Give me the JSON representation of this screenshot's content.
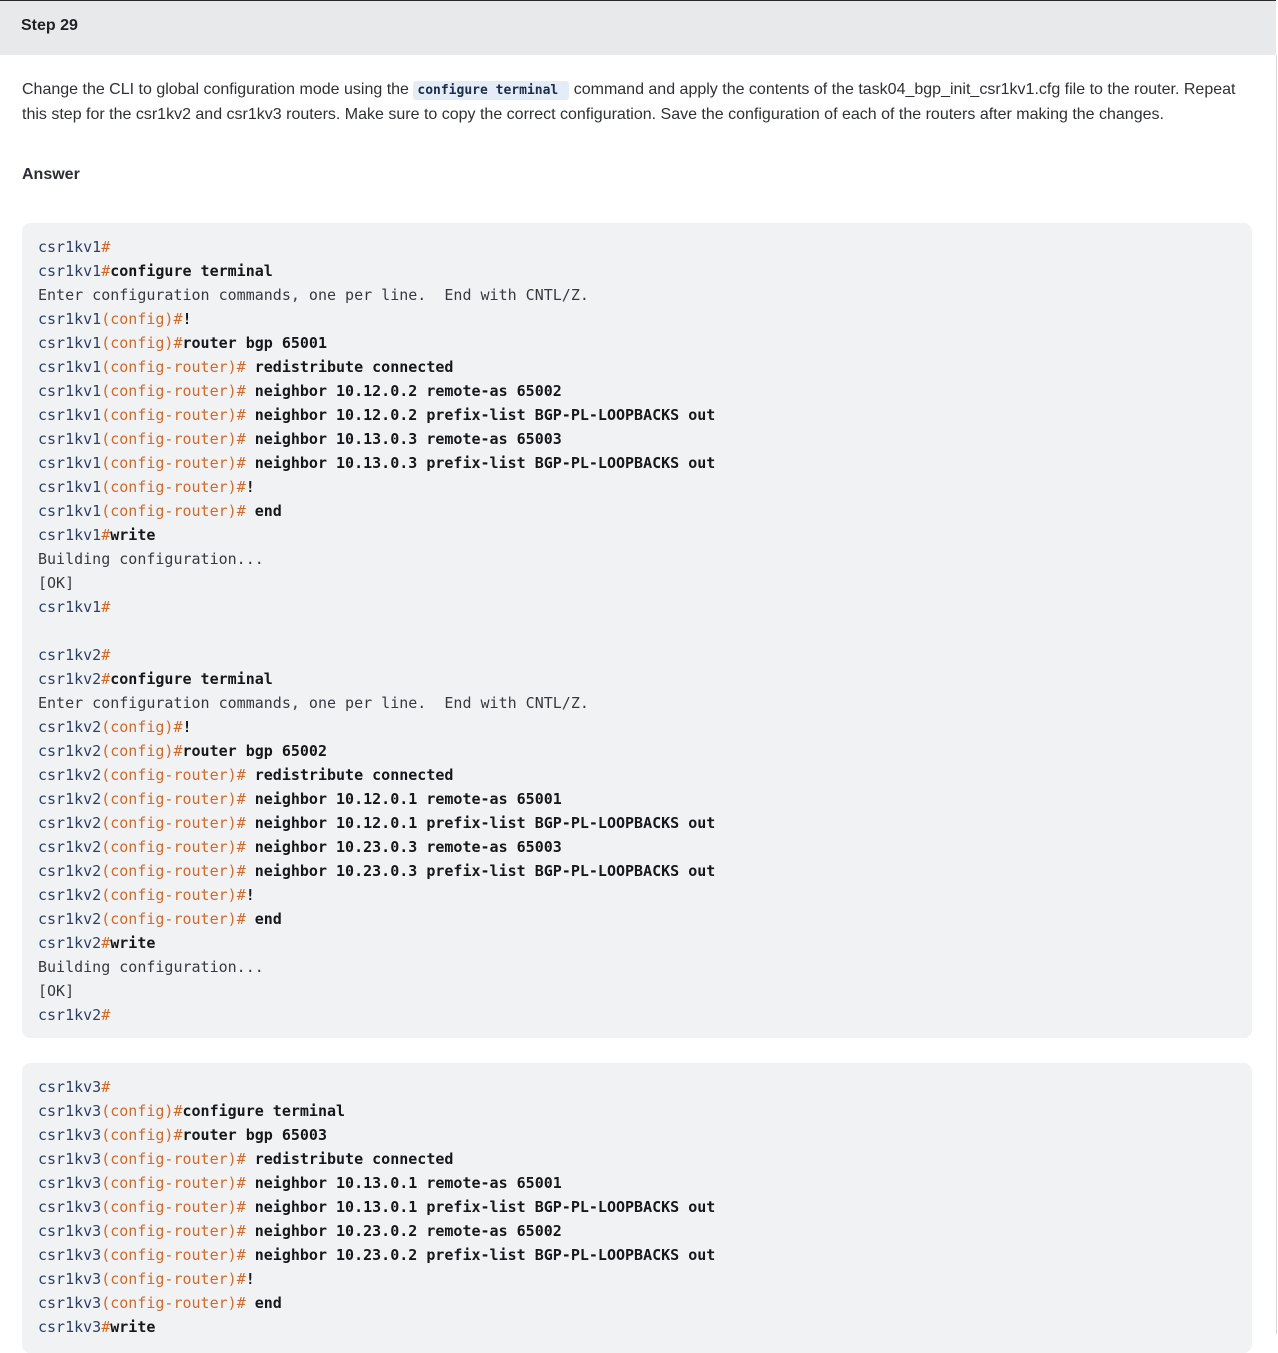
{
  "step": {
    "title": "Step 29"
  },
  "instruction": {
    "text_before": "Change the CLI to global configuration mode using the ",
    "code": "configure terminal",
    "text_after": " command and apply the contents of the task04_bgp_init_csr1kv1.cfg file to the router. Repeat this step for the csr1kv2 and csr1kv3 routers. Make sure to copy the correct configuration. Save the configuration of each of the routers after making the changes."
  },
  "answer_label": "Answer",
  "code_blocks": [
    {
      "lines": [
        {
          "host": "csr1kv1",
          "mode": "",
          "cmd": ""
        },
        {
          "host": "csr1kv1",
          "mode": "",
          "cmd": "configure terminal"
        },
        {
          "output": "Enter configuration commands, one per line.  End with CNTL/Z."
        },
        {
          "host": "csr1kv1",
          "mode": "(config)",
          "cmd": "!"
        },
        {
          "host": "csr1kv1",
          "mode": "(config)",
          "cmd": "router bgp 65001"
        },
        {
          "host": "csr1kv1",
          "mode": "(config-router)",
          "cmd": " redistribute connected"
        },
        {
          "host": "csr1kv1",
          "mode": "(config-router)",
          "cmd": " neighbor 10.12.0.2 remote-as 65002"
        },
        {
          "host": "csr1kv1",
          "mode": "(config-router)",
          "cmd": " neighbor 10.12.0.2 prefix-list BGP-PL-LOOPBACKS out"
        },
        {
          "host": "csr1kv1",
          "mode": "(config-router)",
          "cmd": " neighbor 10.13.0.3 remote-as 65003"
        },
        {
          "host": "csr1kv1",
          "mode": "(config-router)",
          "cmd": " neighbor 10.13.0.3 prefix-list BGP-PL-LOOPBACKS out"
        },
        {
          "host": "csr1kv1",
          "mode": "(config-router)",
          "cmd": "!"
        },
        {
          "host": "csr1kv1",
          "mode": "(config-router)",
          "cmd": " end"
        },
        {
          "host": "csr1kv1",
          "mode": "",
          "cmd": "write"
        },
        {
          "output": "Building configuration..."
        },
        {
          "output": "[OK]"
        },
        {
          "host": "csr1kv1",
          "mode": "",
          "cmd": ""
        },
        {
          "output": ""
        },
        {
          "host": "csr1kv2",
          "mode": "",
          "cmd": ""
        },
        {
          "host": "csr1kv2",
          "mode": "",
          "cmd": "configure terminal"
        },
        {
          "output": "Enter configuration commands, one per line.  End with CNTL/Z."
        },
        {
          "host": "csr1kv2",
          "mode": "(config)",
          "cmd": "!"
        },
        {
          "host": "csr1kv2",
          "mode": "(config)",
          "cmd": "router bgp 65002"
        },
        {
          "host": "csr1kv2",
          "mode": "(config-router)",
          "cmd": " redistribute connected"
        },
        {
          "host": "csr1kv2",
          "mode": "(config-router)",
          "cmd": " neighbor 10.12.0.1 remote-as 65001"
        },
        {
          "host": "csr1kv2",
          "mode": "(config-router)",
          "cmd": " neighbor 10.12.0.1 prefix-list BGP-PL-LOOPBACKS out"
        },
        {
          "host": "csr1kv2",
          "mode": "(config-router)",
          "cmd": " neighbor 10.23.0.3 remote-as 65003"
        },
        {
          "host": "csr1kv2",
          "mode": "(config-router)",
          "cmd": " neighbor 10.23.0.3 prefix-list BGP-PL-LOOPBACKS out"
        },
        {
          "host": "csr1kv2",
          "mode": "(config-router)",
          "cmd": "!"
        },
        {
          "host": "csr1kv2",
          "mode": "(config-router)",
          "cmd": " end"
        },
        {
          "host": "csr1kv2",
          "mode": "",
          "cmd": "write"
        },
        {
          "output": "Building configuration..."
        },
        {
          "output": "[OK]"
        },
        {
          "host": "csr1kv2",
          "mode": "",
          "cmd": ""
        }
      ]
    },
    {
      "lines": [
        {
          "host": "csr1kv3",
          "mode": "",
          "cmd": ""
        },
        {
          "host": "csr1kv3",
          "mode": "(config)",
          "cmd": "configure terminal"
        },
        {
          "host": "csr1kv3",
          "mode": "(config)",
          "cmd": "router bgp 65003"
        },
        {
          "host": "csr1kv3",
          "mode": "(config-router)",
          "cmd": " redistribute connected"
        },
        {
          "host": "csr1kv3",
          "mode": "(config-router)",
          "cmd": " neighbor 10.13.0.1 remote-as 65001"
        },
        {
          "host": "csr1kv3",
          "mode": "(config-router)",
          "cmd": " neighbor 10.13.0.1 prefix-list BGP-PL-LOOPBACKS out"
        },
        {
          "host": "csr1kv3",
          "mode": "(config-router)",
          "cmd": " neighbor 10.23.0.2 remote-as 65002"
        },
        {
          "host": "csr1kv3",
          "mode": "(config-router)",
          "cmd": " neighbor 10.23.0.2 prefix-list BGP-PL-LOOPBACKS out"
        },
        {
          "host": "csr1kv3",
          "mode": "(config-router)",
          "cmd": "!"
        },
        {
          "host": "csr1kv3",
          "mode": "(config-router)",
          "cmd": " end"
        },
        {
          "host": "csr1kv3",
          "mode": "",
          "cmd": "write"
        }
      ]
    }
  ]
}
